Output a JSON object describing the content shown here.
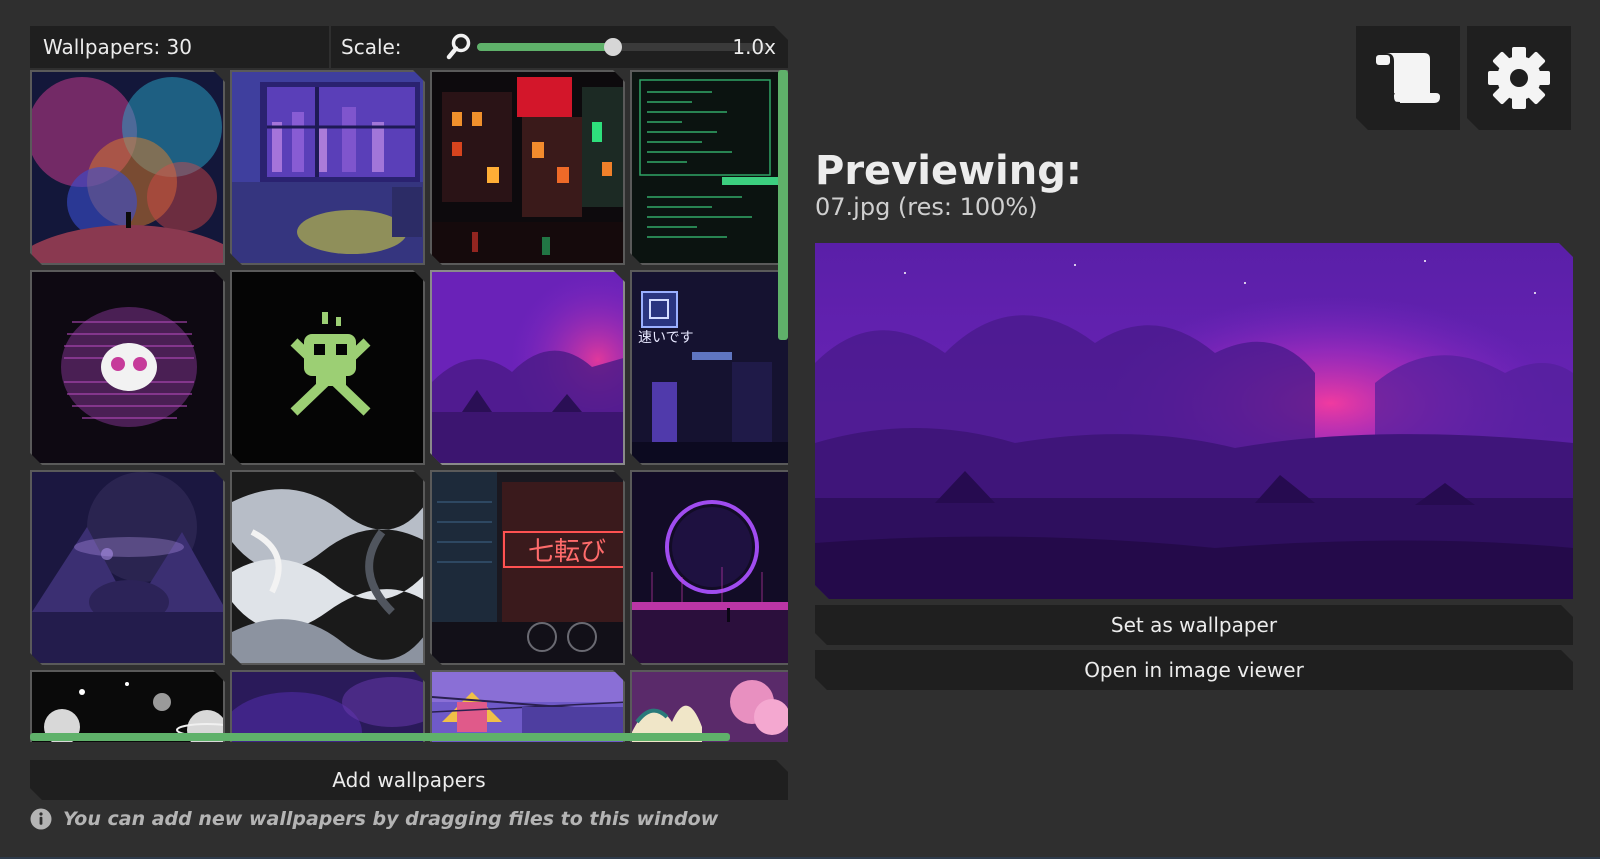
{
  "library": {
    "count_label": "Wallpapers: 30",
    "scale_label": "Scale:",
    "scale_value": "1.0x",
    "scale_slider_fraction": 0.47,
    "add_button": "Add wallpapers",
    "hint": "You can add new wallpapers by dragging files to this window"
  },
  "preview": {
    "title": "Previewing:",
    "filename": "07.jpg (res: 100%)",
    "set_button": "Set as wallpaper",
    "open_button": "Open in image viewer"
  },
  "icons": [
    "magnifier-icon",
    "info-icon",
    "scroll-icon",
    "gear-icon"
  ],
  "colors": {
    "background": "#2f2f2f",
    "panel": "#1f1f1f",
    "accent": "#5fb16a"
  }
}
